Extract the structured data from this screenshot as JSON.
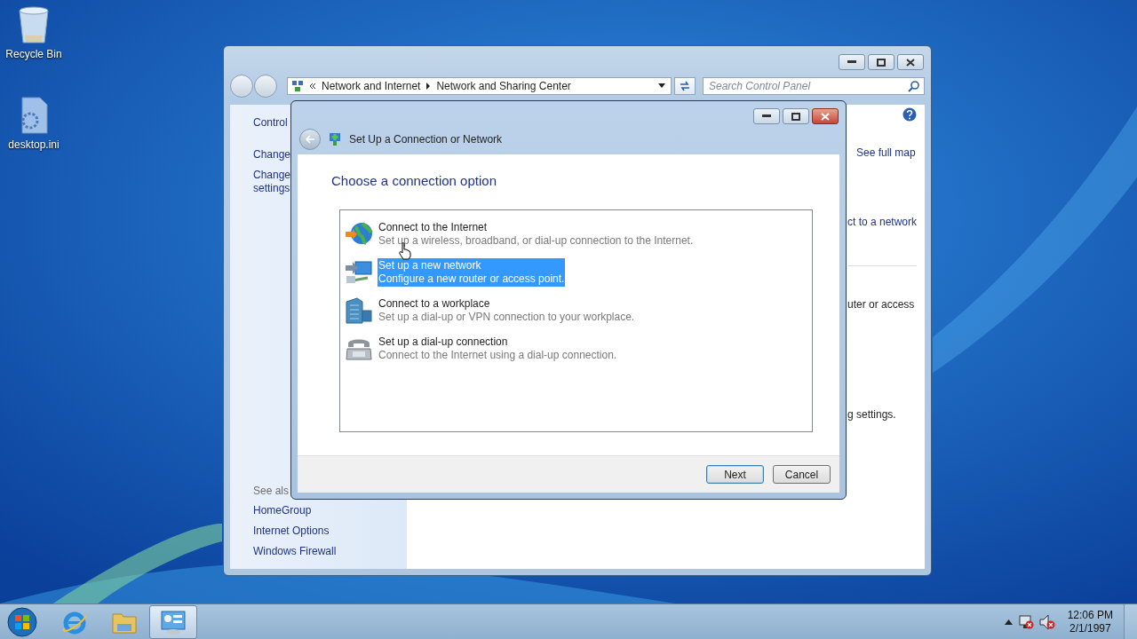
{
  "desktop_icons": [
    {
      "kind": "recycle-bin",
      "label": "Recycle Bin"
    },
    {
      "kind": "file",
      "label": "desktop.ini"
    }
  ],
  "main_window": {
    "breadcrumb": [
      "Network and Internet",
      "Network and Sharing Center"
    ],
    "search": {
      "placeholder": "Search Control Panel"
    },
    "left_links": [
      "Control",
      "Change",
      "Change settings"
    ],
    "see_also": {
      "heading": "See als",
      "links": [
        "HomeGroup",
        "Internet Options",
        "Windows Firewall"
      ]
    },
    "right_texts": [
      {
        "kind": "link",
        "text": "See full map"
      },
      {
        "kind": "link",
        "text": "ct to a network"
      },
      {
        "kind": "text",
        "text": "uter or access"
      },
      {
        "kind": "text",
        "text": "g settings."
      }
    ]
  },
  "dialog": {
    "title": "Set Up a Connection or Network",
    "heading": "Choose a connection option",
    "options": [
      {
        "kind": "internet",
        "title": "Connect to the Internet",
        "description": "Set up a wireless, broadband, or dial-up connection to the Internet.",
        "selected": false
      },
      {
        "kind": "network",
        "title": "Set up a new network",
        "description": "Configure a new router or access point.",
        "selected": true
      },
      {
        "kind": "workplace",
        "title": "Connect to a workplace",
        "description": "Set up a dial-up or VPN connection to your workplace.",
        "selected": false
      },
      {
        "kind": "dialup",
        "title": "Set up a dial-up connection",
        "description": "Connect to the Internet using a dial-up connection.",
        "selected": false
      }
    ],
    "buttons": [
      {
        "label": "Next",
        "default": true
      },
      {
        "label": "Cancel",
        "default": false
      }
    ]
  },
  "taskbar": {
    "apps": [
      {
        "kind": "ie",
        "active": false
      },
      {
        "kind": "explorer",
        "active": false
      },
      {
        "kind": "control-panel",
        "active": true
      }
    ],
    "clock": {
      "time": "12:06 PM",
      "date": "2/1/1997"
    }
  }
}
